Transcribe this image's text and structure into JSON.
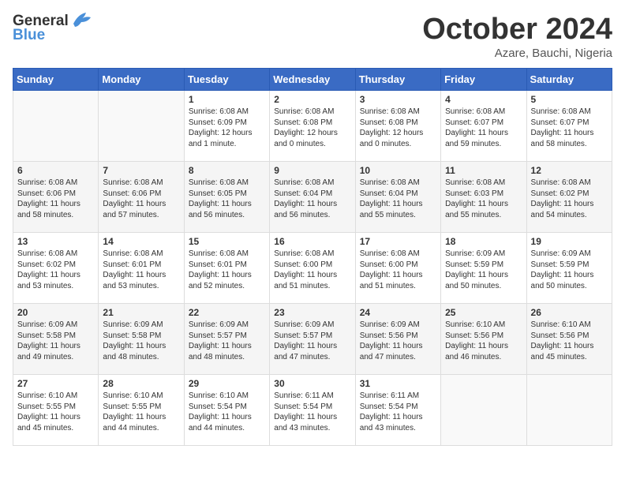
{
  "logo": {
    "general": "General",
    "blue": "Blue"
  },
  "title": "October 2024",
  "location": "Azare, Bauchi, Nigeria",
  "weekdays": [
    "Sunday",
    "Monday",
    "Tuesday",
    "Wednesday",
    "Thursday",
    "Friday",
    "Saturday"
  ],
  "weeks": [
    [
      {
        "day": "",
        "content": ""
      },
      {
        "day": "",
        "content": ""
      },
      {
        "day": "1",
        "content": "Sunrise: 6:08 AM\nSunset: 6:09 PM\nDaylight: 12 hours and 1 minute."
      },
      {
        "day": "2",
        "content": "Sunrise: 6:08 AM\nSunset: 6:08 PM\nDaylight: 12 hours and 0 minutes."
      },
      {
        "day": "3",
        "content": "Sunrise: 6:08 AM\nSunset: 6:08 PM\nDaylight: 12 hours and 0 minutes."
      },
      {
        "day": "4",
        "content": "Sunrise: 6:08 AM\nSunset: 6:07 PM\nDaylight: 11 hours and 59 minutes."
      },
      {
        "day": "5",
        "content": "Sunrise: 6:08 AM\nSunset: 6:07 PM\nDaylight: 11 hours and 58 minutes."
      }
    ],
    [
      {
        "day": "6",
        "content": "Sunrise: 6:08 AM\nSunset: 6:06 PM\nDaylight: 11 hours and 58 minutes."
      },
      {
        "day": "7",
        "content": "Sunrise: 6:08 AM\nSunset: 6:06 PM\nDaylight: 11 hours and 57 minutes."
      },
      {
        "day": "8",
        "content": "Sunrise: 6:08 AM\nSunset: 6:05 PM\nDaylight: 11 hours and 56 minutes."
      },
      {
        "day": "9",
        "content": "Sunrise: 6:08 AM\nSunset: 6:04 PM\nDaylight: 11 hours and 56 minutes."
      },
      {
        "day": "10",
        "content": "Sunrise: 6:08 AM\nSunset: 6:04 PM\nDaylight: 11 hours and 55 minutes."
      },
      {
        "day": "11",
        "content": "Sunrise: 6:08 AM\nSunset: 6:03 PM\nDaylight: 11 hours and 55 minutes."
      },
      {
        "day": "12",
        "content": "Sunrise: 6:08 AM\nSunset: 6:02 PM\nDaylight: 11 hours and 54 minutes."
      }
    ],
    [
      {
        "day": "13",
        "content": "Sunrise: 6:08 AM\nSunset: 6:02 PM\nDaylight: 11 hours and 53 minutes."
      },
      {
        "day": "14",
        "content": "Sunrise: 6:08 AM\nSunset: 6:01 PM\nDaylight: 11 hours and 53 minutes."
      },
      {
        "day": "15",
        "content": "Sunrise: 6:08 AM\nSunset: 6:01 PM\nDaylight: 11 hours and 52 minutes."
      },
      {
        "day": "16",
        "content": "Sunrise: 6:08 AM\nSunset: 6:00 PM\nDaylight: 11 hours and 51 minutes."
      },
      {
        "day": "17",
        "content": "Sunrise: 6:08 AM\nSunset: 6:00 PM\nDaylight: 11 hours and 51 minutes."
      },
      {
        "day": "18",
        "content": "Sunrise: 6:09 AM\nSunset: 5:59 PM\nDaylight: 11 hours and 50 minutes."
      },
      {
        "day": "19",
        "content": "Sunrise: 6:09 AM\nSunset: 5:59 PM\nDaylight: 11 hours and 50 minutes."
      }
    ],
    [
      {
        "day": "20",
        "content": "Sunrise: 6:09 AM\nSunset: 5:58 PM\nDaylight: 11 hours and 49 minutes."
      },
      {
        "day": "21",
        "content": "Sunrise: 6:09 AM\nSunset: 5:58 PM\nDaylight: 11 hours and 48 minutes."
      },
      {
        "day": "22",
        "content": "Sunrise: 6:09 AM\nSunset: 5:57 PM\nDaylight: 11 hours and 48 minutes."
      },
      {
        "day": "23",
        "content": "Sunrise: 6:09 AM\nSunset: 5:57 PM\nDaylight: 11 hours and 47 minutes."
      },
      {
        "day": "24",
        "content": "Sunrise: 6:09 AM\nSunset: 5:56 PM\nDaylight: 11 hours and 47 minutes."
      },
      {
        "day": "25",
        "content": "Sunrise: 6:10 AM\nSunset: 5:56 PM\nDaylight: 11 hours and 46 minutes."
      },
      {
        "day": "26",
        "content": "Sunrise: 6:10 AM\nSunset: 5:56 PM\nDaylight: 11 hours and 45 minutes."
      }
    ],
    [
      {
        "day": "27",
        "content": "Sunrise: 6:10 AM\nSunset: 5:55 PM\nDaylight: 11 hours and 45 minutes."
      },
      {
        "day": "28",
        "content": "Sunrise: 6:10 AM\nSunset: 5:55 PM\nDaylight: 11 hours and 44 minutes."
      },
      {
        "day": "29",
        "content": "Sunrise: 6:10 AM\nSunset: 5:54 PM\nDaylight: 11 hours and 44 minutes."
      },
      {
        "day": "30",
        "content": "Sunrise: 6:11 AM\nSunset: 5:54 PM\nDaylight: 11 hours and 43 minutes."
      },
      {
        "day": "31",
        "content": "Sunrise: 6:11 AM\nSunset: 5:54 PM\nDaylight: 11 hours and 43 minutes."
      },
      {
        "day": "",
        "content": ""
      },
      {
        "day": "",
        "content": ""
      }
    ]
  ]
}
